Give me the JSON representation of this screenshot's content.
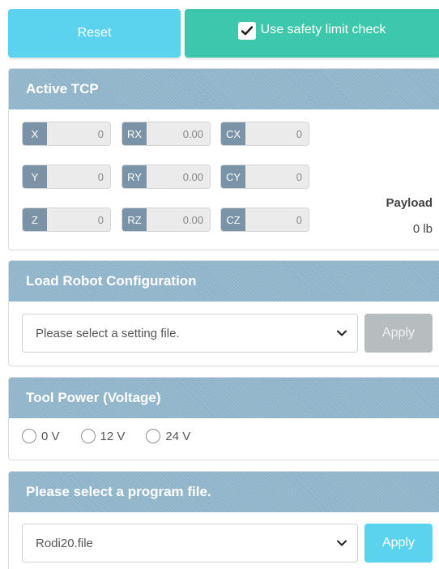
{
  "top": {
    "reset_label": "Reset",
    "safety_label": "Use safety limit check",
    "safety_checked": true
  },
  "tcp": {
    "title": "Active TCP",
    "fields": [
      {
        "label": "X",
        "value": "0"
      },
      {
        "label": "RX",
        "value": "0.00"
      },
      {
        "label": "CX",
        "value": "0"
      },
      {
        "label": "Y",
        "value": "0"
      },
      {
        "label": "RY",
        "value": "0.00"
      },
      {
        "label": "CY",
        "value": "0"
      },
      {
        "label": "Z",
        "value": "0"
      },
      {
        "label": "RZ",
        "value": "0.00"
      },
      {
        "label": "CZ",
        "value": "0"
      }
    ],
    "payload_label": "Payload",
    "payload_value": "0 lb"
  },
  "config": {
    "title": "Load Robot Configuration",
    "select_value": "Please select a setting file.",
    "apply_label": "Apply"
  },
  "power": {
    "title": "Tool Power (Voltage)",
    "options": [
      "0 V",
      "12 V",
      "24 V"
    ]
  },
  "program": {
    "title": "Please select a program file.",
    "select_value": "Rodi20.file",
    "apply_label": "Apply"
  },
  "colors": {
    "reset": "#5bd3ee",
    "safety": "#3dc7ac",
    "header": "#8fb4c9",
    "tag": "#7b93a6",
    "apply_disabled": "#b7bcbf",
    "apply_active": "#5bd3ee"
  },
  "icons": {
    "checkbox": "check-icon",
    "select": "chevron-down-icon"
  }
}
